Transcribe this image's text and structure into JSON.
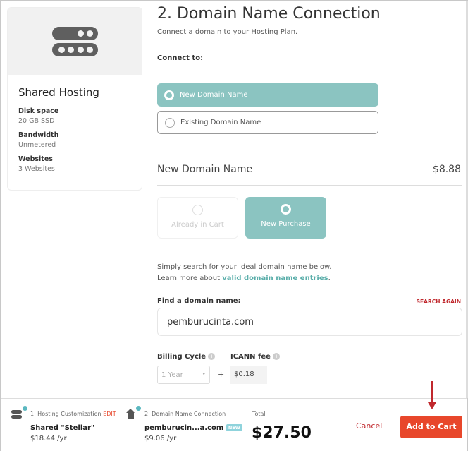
{
  "plan_card": {
    "title": "Shared Hosting",
    "icon": "server-icon",
    "specs": [
      {
        "label": "Disk space",
        "value": "20 GB SSD"
      },
      {
        "label": "Bandwidth",
        "value": "Unmetered"
      },
      {
        "label": "Websites",
        "value": "3 Websites"
      }
    ]
  },
  "main": {
    "title": "2. Domain Name Connection",
    "subtitle": "Connect a domain to your Hosting Plan.",
    "connect_label": "Connect to:",
    "options": [
      {
        "label": "New Domain Name",
        "selected": true
      },
      {
        "label": "Existing Domain Name",
        "selected": false
      }
    ],
    "section_title": "New Domain Name",
    "section_price": "$8.88",
    "tiles": [
      {
        "label": "Already in Cart",
        "disabled": true
      },
      {
        "label": "New Purchase",
        "selected": true
      }
    ],
    "help_line1": "Simply search for your ideal domain name below.",
    "help_line2_prefix": "Learn more about ",
    "help_link": "valid domain name entries",
    "help_suffix": ".",
    "find_label": "Find a domain name:",
    "search_again": "SEARCH AGAIN",
    "domain_value": "pemburucinta.com",
    "billing_label": "Billing Cycle",
    "billing_value": "1 Year",
    "plus": "+",
    "icann_label": "ICANN fee",
    "icann_value": "$0.18"
  },
  "footer": {
    "step1": {
      "label": "1. Hosting Customization",
      "edit": "EDIT",
      "name": "Shared \"Stellar\"",
      "price": "$18.44 /yr"
    },
    "step2": {
      "label": "2. Domain Name Connection",
      "name": "pemburucin...a.com",
      "badge": "NEW",
      "price": "$9.06 /yr"
    },
    "total_label": "Total",
    "total": "$27.50",
    "cancel": "Cancel",
    "add": "Add to Cart"
  },
  "colors": {
    "accent": "#8bc4c1",
    "red": "#e8472b",
    "link": "#5aaeaa"
  }
}
